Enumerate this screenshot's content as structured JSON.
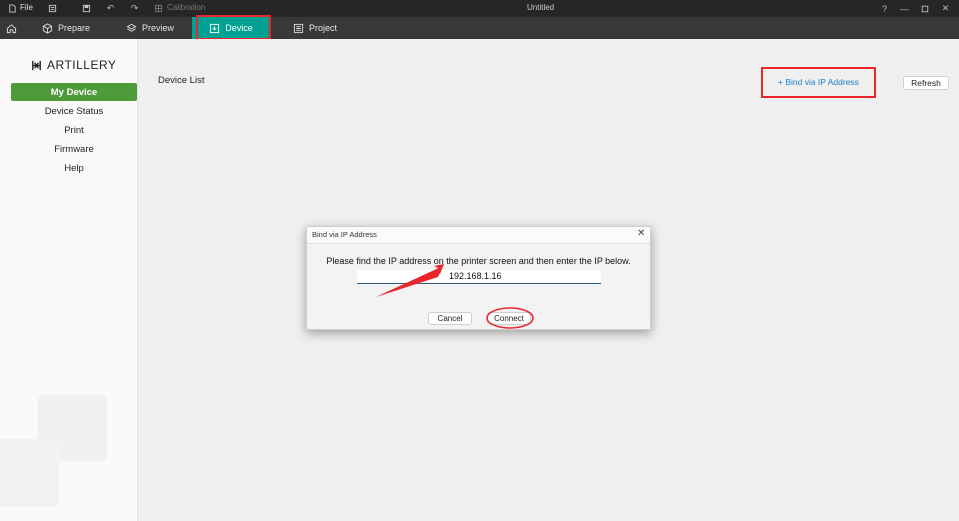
{
  "titlebar": {
    "file_label": "File",
    "calibration_label": "Calibration",
    "window_title": "Untitled"
  },
  "tabs": [
    {
      "label": "Prepare"
    },
    {
      "label": "Preview"
    },
    {
      "label": "Device"
    },
    {
      "label": "Project"
    }
  ],
  "brand": {
    "logo_text": "ARTILLERY"
  },
  "sidebar": {
    "items": [
      {
        "label": "My Device"
      },
      {
        "label": "Device Status"
      },
      {
        "label": "Print"
      },
      {
        "label": "Firmware"
      },
      {
        "label": "Help"
      }
    ]
  },
  "main": {
    "section_title": "Device List",
    "bind_ip_label": "+ Bind via IP Address",
    "refresh_label": "Refresh"
  },
  "dialog": {
    "title": "Bind via IP Address",
    "instruction": "Please find the IP address on the printer screen and then enter the IP below.",
    "ip_value": "192.168.1.16",
    "cancel_label": "Cancel",
    "connect_label": "Connect"
  },
  "colors": {
    "accent_tab": "#00a192",
    "active_sidebar": "#4f9a3b",
    "annotation_red": "#e8262b",
    "link_blue": "#1a7fd0"
  }
}
